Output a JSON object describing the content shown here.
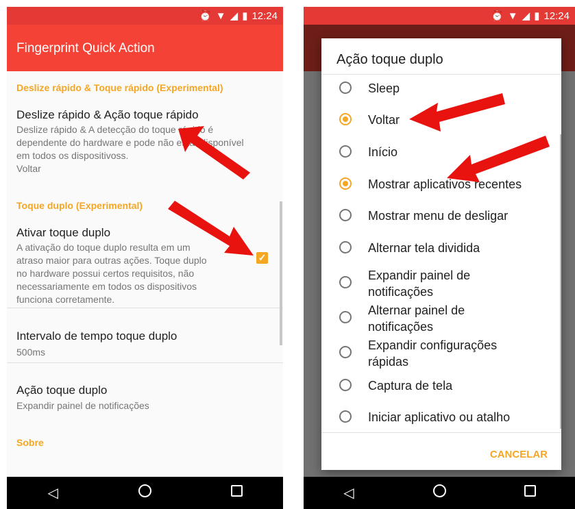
{
  "status_bar": {
    "time": "12:24"
  },
  "left": {
    "app_title": "Fingerprint Quick Action",
    "cat_swipe": "Deslize rápido & Toque rápido (Experimental)",
    "swipe_title": "Deslize rápido & Ação toque rápido",
    "swipe_summary": "Deslize rápido & A detecção do toque rápido é\ndependente do hardware e pode não estar disponível\nem todos os dispositivoss.\nVoltar",
    "cat_double": "Toque duplo (Experimental)",
    "double_title": "Ativar toque duplo",
    "double_summary": "A ativação do toque duplo resulta em um\natraso maior para outras ações. Toque duplo\nno hardware possui certos requisitos, não\nnecessariamente em todos os dispositivos\nfunciona corretamente.",
    "double_checked": true,
    "interval_title": "Intervalo de tempo toque duplo",
    "interval_value": "500ms",
    "action_title": "Ação toque duplo",
    "action_value": "Expandir painel de notificações",
    "cat_about": "Sobre"
  },
  "dialog": {
    "title": "Ação toque duplo",
    "options": [
      {
        "label": "Sleep",
        "selected": false
      },
      {
        "label": "Voltar",
        "selected": true
      },
      {
        "label": "Início",
        "selected": false
      },
      {
        "label": "Mostrar aplicativos recentes",
        "selected": true
      },
      {
        "label": "Mostrar menu de desligar",
        "selected": false
      },
      {
        "label": "Alternar tela dividida",
        "selected": false
      },
      {
        "label": "Expandir painel de\nnotificações",
        "selected": false
      },
      {
        "label": "Alternar painel de\nnotificações",
        "selected": false
      },
      {
        "label": "Expandir configurações\nrápidas",
        "selected": false
      },
      {
        "label": "Captura de tela",
        "selected": false
      },
      {
        "label": "Iniciar aplicativo ou atalho",
        "selected": false
      }
    ],
    "cancel": "CANCELAR"
  },
  "colors": {
    "appbar": "#f44336",
    "accent": "#f5a623",
    "arrow": "#e8130f"
  },
  "icons": [
    "alarm-icon",
    "wifi-icon",
    "signal-icon",
    "battery-icon",
    "back-icon",
    "home-icon",
    "recents-icon",
    "arrow-annotation"
  ]
}
